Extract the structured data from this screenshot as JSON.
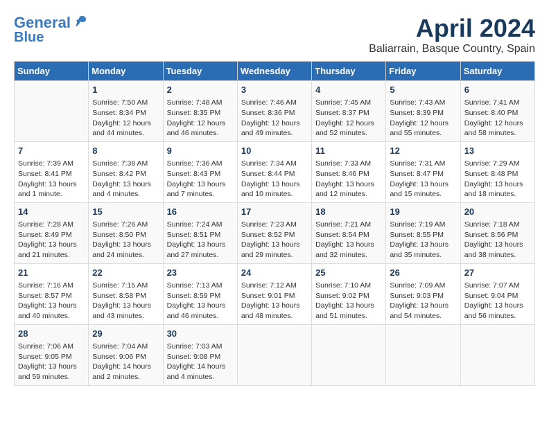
{
  "logo": {
    "line1": "General",
    "line2": "Blue"
  },
  "title": "April 2024",
  "subtitle": "Baliarrain, Basque Country, Spain",
  "weekdays": [
    "Sunday",
    "Monday",
    "Tuesday",
    "Wednesday",
    "Thursday",
    "Friday",
    "Saturday"
  ],
  "weeks": [
    [
      {
        "day": "",
        "info": ""
      },
      {
        "day": "1",
        "info": "Sunrise: 7:50 AM\nSunset: 8:34 PM\nDaylight: 12 hours\nand 44 minutes."
      },
      {
        "day": "2",
        "info": "Sunrise: 7:48 AM\nSunset: 8:35 PM\nDaylight: 12 hours\nand 46 minutes."
      },
      {
        "day": "3",
        "info": "Sunrise: 7:46 AM\nSunset: 8:36 PM\nDaylight: 12 hours\nand 49 minutes."
      },
      {
        "day": "4",
        "info": "Sunrise: 7:45 AM\nSunset: 8:37 PM\nDaylight: 12 hours\nand 52 minutes."
      },
      {
        "day": "5",
        "info": "Sunrise: 7:43 AM\nSunset: 8:39 PM\nDaylight: 12 hours\nand 55 minutes."
      },
      {
        "day": "6",
        "info": "Sunrise: 7:41 AM\nSunset: 8:40 PM\nDaylight: 12 hours\nand 58 minutes."
      }
    ],
    [
      {
        "day": "7",
        "info": "Sunrise: 7:39 AM\nSunset: 8:41 PM\nDaylight: 13 hours\nand 1 minute."
      },
      {
        "day": "8",
        "info": "Sunrise: 7:38 AM\nSunset: 8:42 PM\nDaylight: 13 hours\nand 4 minutes."
      },
      {
        "day": "9",
        "info": "Sunrise: 7:36 AM\nSunset: 8:43 PM\nDaylight: 13 hours\nand 7 minutes."
      },
      {
        "day": "10",
        "info": "Sunrise: 7:34 AM\nSunset: 8:44 PM\nDaylight: 13 hours\nand 10 minutes."
      },
      {
        "day": "11",
        "info": "Sunrise: 7:33 AM\nSunset: 8:46 PM\nDaylight: 13 hours\nand 12 minutes."
      },
      {
        "day": "12",
        "info": "Sunrise: 7:31 AM\nSunset: 8:47 PM\nDaylight: 13 hours\nand 15 minutes."
      },
      {
        "day": "13",
        "info": "Sunrise: 7:29 AM\nSunset: 8:48 PM\nDaylight: 13 hours\nand 18 minutes."
      }
    ],
    [
      {
        "day": "14",
        "info": "Sunrise: 7:28 AM\nSunset: 8:49 PM\nDaylight: 13 hours\nand 21 minutes."
      },
      {
        "day": "15",
        "info": "Sunrise: 7:26 AM\nSunset: 8:50 PM\nDaylight: 13 hours\nand 24 minutes."
      },
      {
        "day": "16",
        "info": "Sunrise: 7:24 AM\nSunset: 8:51 PM\nDaylight: 13 hours\nand 27 minutes."
      },
      {
        "day": "17",
        "info": "Sunrise: 7:23 AM\nSunset: 8:52 PM\nDaylight: 13 hours\nand 29 minutes."
      },
      {
        "day": "18",
        "info": "Sunrise: 7:21 AM\nSunset: 8:54 PM\nDaylight: 13 hours\nand 32 minutes."
      },
      {
        "day": "19",
        "info": "Sunrise: 7:19 AM\nSunset: 8:55 PM\nDaylight: 13 hours\nand 35 minutes."
      },
      {
        "day": "20",
        "info": "Sunrise: 7:18 AM\nSunset: 8:56 PM\nDaylight: 13 hours\nand 38 minutes."
      }
    ],
    [
      {
        "day": "21",
        "info": "Sunrise: 7:16 AM\nSunset: 8:57 PM\nDaylight: 13 hours\nand 40 minutes."
      },
      {
        "day": "22",
        "info": "Sunrise: 7:15 AM\nSunset: 8:58 PM\nDaylight: 13 hours\nand 43 minutes."
      },
      {
        "day": "23",
        "info": "Sunrise: 7:13 AM\nSunset: 8:59 PM\nDaylight: 13 hours\nand 46 minutes."
      },
      {
        "day": "24",
        "info": "Sunrise: 7:12 AM\nSunset: 9:01 PM\nDaylight: 13 hours\nand 48 minutes."
      },
      {
        "day": "25",
        "info": "Sunrise: 7:10 AM\nSunset: 9:02 PM\nDaylight: 13 hours\nand 51 minutes."
      },
      {
        "day": "26",
        "info": "Sunrise: 7:09 AM\nSunset: 9:03 PM\nDaylight: 13 hours\nand 54 minutes."
      },
      {
        "day": "27",
        "info": "Sunrise: 7:07 AM\nSunset: 9:04 PM\nDaylight: 13 hours\nand 56 minutes."
      }
    ],
    [
      {
        "day": "28",
        "info": "Sunrise: 7:06 AM\nSunset: 9:05 PM\nDaylight: 13 hours\nand 59 minutes."
      },
      {
        "day": "29",
        "info": "Sunrise: 7:04 AM\nSunset: 9:06 PM\nDaylight: 14 hours\nand 2 minutes."
      },
      {
        "day": "30",
        "info": "Sunrise: 7:03 AM\nSunset: 9:08 PM\nDaylight: 14 hours\nand 4 minutes."
      },
      {
        "day": "",
        "info": ""
      },
      {
        "day": "",
        "info": ""
      },
      {
        "day": "",
        "info": ""
      },
      {
        "day": "",
        "info": ""
      }
    ]
  ]
}
